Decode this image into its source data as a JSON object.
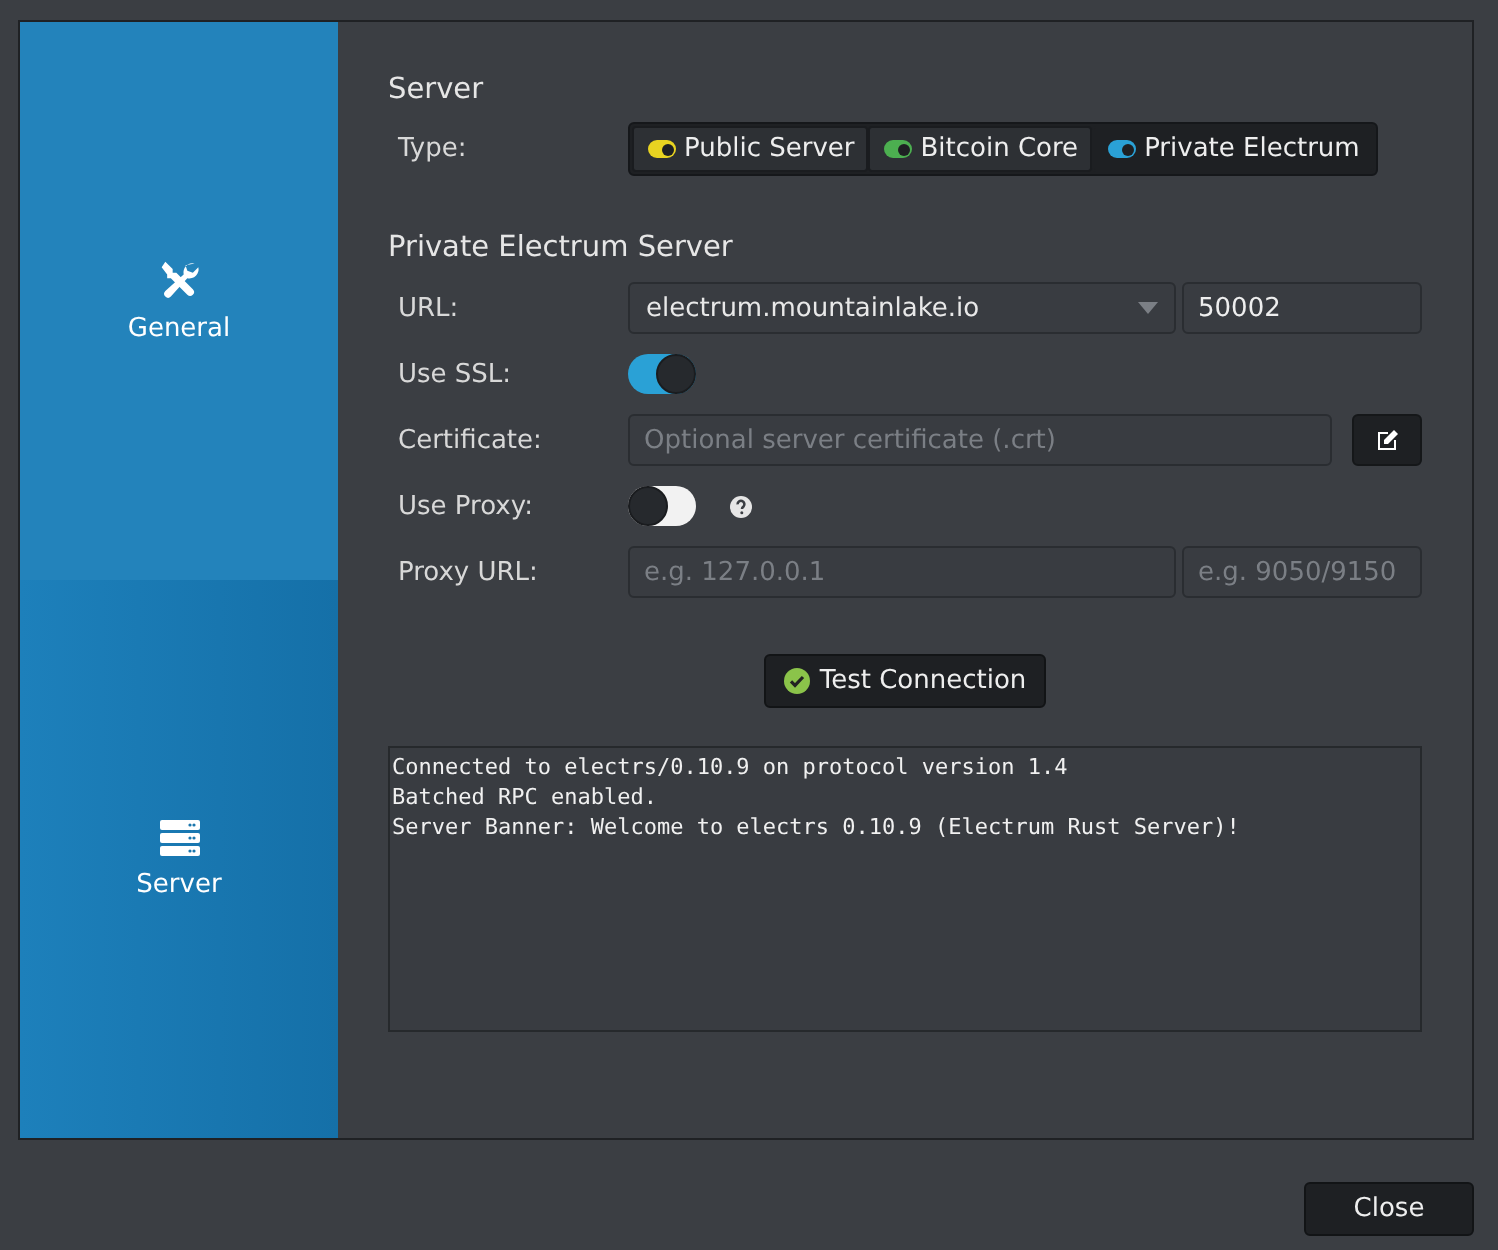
{
  "sidebar": {
    "items": [
      {
        "label": "General",
        "kind": "tools",
        "selected": false
      },
      {
        "label": "Server",
        "kind": "server",
        "selected": true
      }
    ]
  },
  "server_section": {
    "title": "Server",
    "type_label": "Type:",
    "types": [
      {
        "label": "Public Server",
        "color": "#e8d321",
        "selected": false
      },
      {
        "label": "Bitcoin Core",
        "color": "#4caf50",
        "selected": false
      },
      {
        "label": "Private Electrum",
        "color": "#2aa1d6",
        "selected": true
      }
    ]
  },
  "private_section": {
    "title": "Private Electrum Server",
    "url": {
      "label": "URL:",
      "value": "electrum.mountainlake.io",
      "port": "50002"
    },
    "use_ssl": {
      "label": "Use SSL:",
      "on": true
    },
    "certificate": {
      "label": "Certificate:",
      "placeholder": "Optional server certificate (.crt)"
    },
    "use_proxy": {
      "label": "Use Proxy:",
      "on": false
    },
    "proxy_url": {
      "label": "Proxy URL:",
      "placeholder": "e.g. 127.0.0.1",
      "port_placeholder": "e.g. 9050/9150"
    }
  },
  "test_button": "Test Connection",
  "log": [
    "Connected to electrs/0.10.9 on protocol version 1.4",
    "Batched RPC enabled.",
    "Server Banner: Welcome to electrs 0.10.9 (Electrum Rust Server)!"
  ],
  "close_button": "Close"
}
